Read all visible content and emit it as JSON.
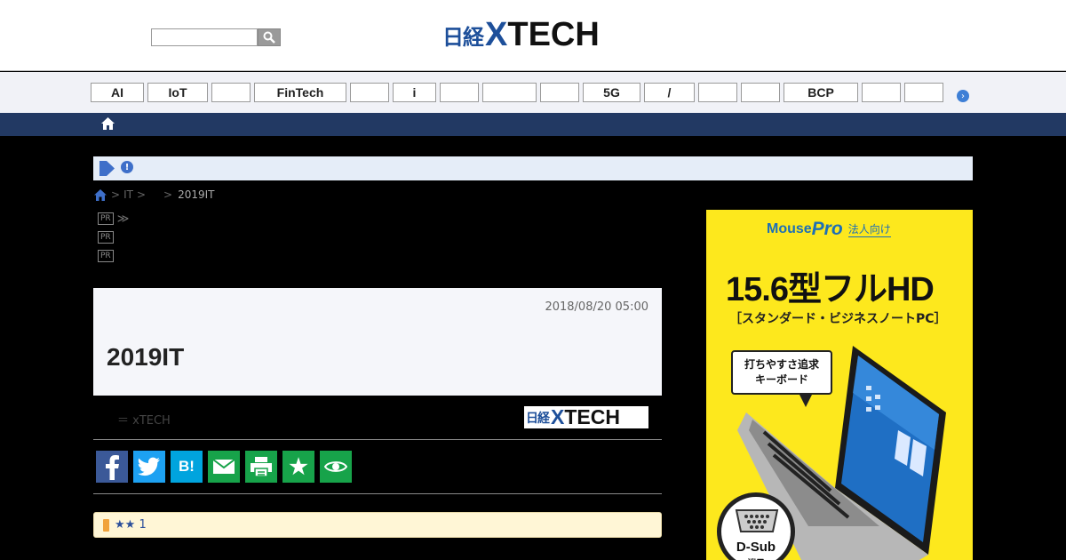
{
  "header": {
    "search": {
      "value": "",
      "placeholder": ""
    },
    "logo": {
      "ja": "日経",
      "x": "X",
      "en": "TECH"
    }
  },
  "categories": [
    "AI",
    "IoT",
    "",
    "FinTech",
    "",
    "i",
    "",
    "",
    "",
    "5G",
    "/",
    "",
    "",
    "BCP",
    "",
    ""
  ],
  "breadcrumb": {
    "sep1": ">",
    "it": "IT",
    "sep2": ">",
    "sep3": ">",
    "current": "2019IT"
  },
  "pr_links": [
    {
      "badge": "PR",
      "arrow": "≫"
    },
    {
      "badge": "PR",
      "arrow": ""
    },
    {
      "badge": "PR",
      "arrow": ""
    }
  ],
  "article": {
    "date": "2018/08/20 05:00",
    "title": "2019IT",
    "author": "＝ xTECH",
    "source_logo": {
      "ja": "日経",
      "x": "X",
      "en": "TECH"
    }
  },
  "shares": [
    {
      "label": "f",
      "color": "#3b5998"
    },
    {
      "label": "twitter",
      "color": "#1da1f2"
    },
    {
      "label": "B!",
      "color": "#00a4de"
    },
    {
      "label": "mail",
      "color": "#17a34a"
    },
    {
      "label": "print",
      "color": "#17a34a"
    },
    {
      "label": "★",
      "color": "#17a34a"
    },
    {
      "label": "eye",
      "color": "#17a34a"
    }
  ],
  "recommend": {
    "text": "★★ 1"
  },
  "ad": {
    "brand_mouse": "Mouse",
    "brand_pro": "Pro",
    "brand_corp": "法人向け",
    "headline": "15.6型フルHD",
    "subline": "［スタンダード・ビジネスノートPC］",
    "bubble_line1": "打ちやすさ追求",
    "bubble_line2": "キーボード",
    "dsub": "D-Sub",
    "dsub_sub": "端子"
  },
  "colors": {
    "brand_blue": "#1d4f9a",
    "nav_blue": "#223963",
    "notice_bg": "#e5edf8",
    "ad_yellow": "#fde81d"
  }
}
